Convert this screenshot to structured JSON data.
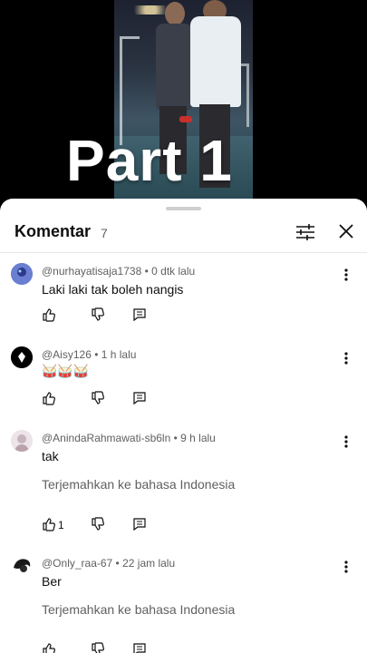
{
  "video": {
    "caption": "Part 1"
  },
  "sheet": {
    "title": "Komentar",
    "count": "7",
    "icons": {
      "filter": "sliders-icon",
      "close": "close-icon"
    }
  },
  "comments": [
    {
      "author": "@nurhayatisaja1738",
      "time": "0 dtk lalu",
      "text": "Laki laki tak boleh nangis",
      "translate": "",
      "likes": ""
    },
    {
      "author": "@Aisy126",
      "time": "1 h lalu",
      "text": "🥁🥁🥁",
      "translate": "",
      "likes": ""
    },
    {
      "author": "@AnindaRahmawati-sb6ln",
      "time": "9 h lalu",
      "text": "tak",
      "translate": "Terjemahkan ke bahasa Indonesia",
      "likes": "1"
    },
    {
      "author": "@Only_raa-67",
      "time": "22 jam lalu",
      "text": "Ber",
      "translate": "Terjemahkan ke bahasa Indonesia",
      "likes": ""
    }
  ],
  "separator": " • ",
  "icons": {
    "like": "thumb-up-icon",
    "dislike": "thumb-down-icon",
    "reply": "reply-icon",
    "more": "more-vertical-icon"
  },
  "colors": {
    "sheet_bg": "#ffffff",
    "text": "#0f0f0f",
    "secondary": "#606060"
  }
}
